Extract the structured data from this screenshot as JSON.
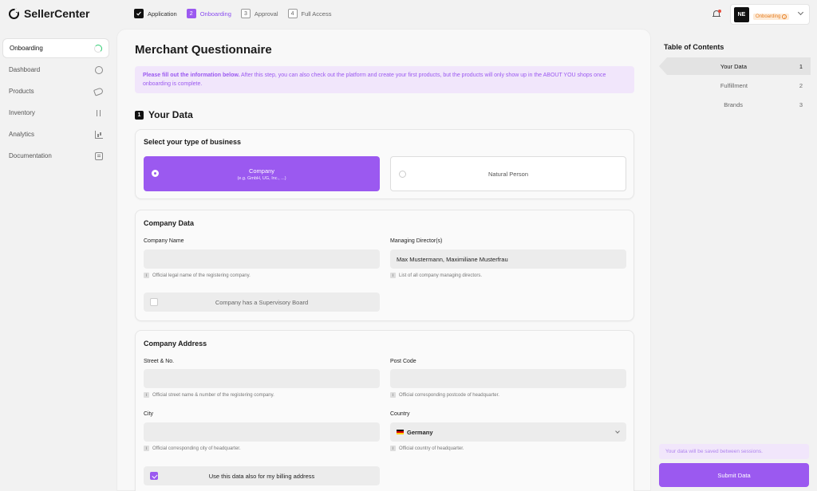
{
  "app": {
    "name": "SellerCenter"
  },
  "steps": [
    {
      "num": "",
      "label": "Application",
      "state": "done"
    },
    {
      "num": "2",
      "label": "Onboarding",
      "state": "active"
    },
    {
      "num": "3",
      "label": "Approval",
      "state": "pending"
    },
    {
      "num": "4",
      "label": "Full Access",
      "state": "pending"
    }
  ],
  "account": {
    "initials": "NE",
    "badge": "Onboarding",
    "badge_info": "i"
  },
  "sidebar": {
    "items": [
      {
        "label": "Onboarding",
        "icon": "progress-icon"
      },
      {
        "label": "Dashboard",
        "icon": "dashboard-icon"
      },
      {
        "label": "Products",
        "icon": "tag-icon"
      },
      {
        "label": "Inventory",
        "icon": "sort-icon"
      },
      {
        "label": "Analytics",
        "icon": "chart-icon"
      },
      {
        "label": "Documentation",
        "icon": "document-icon"
      }
    ]
  },
  "main": {
    "title": "Merchant Questionnaire",
    "notice_bold": "Please fill out the information below.",
    "notice_text": " After this step, you can also check out the platform and create your first products, but the products will only show up in the ABOUT YOU shops once onboarding is complete.",
    "section": {
      "num": "1",
      "title": "Your Data"
    },
    "business": {
      "title": "Select your type of business",
      "options": [
        {
          "label": "Company",
          "sub": "(e.g. GmbH, UG, Inc., ...)"
        },
        {
          "label": "Natural Person"
        }
      ]
    },
    "company": {
      "title": "Company Data",
      "name_label": "Company Name",
      "name_value": "",
      "name_help": "Official legal name of the registering company.",
      "directors_label": "Managing Director(s)",
      "directors_value": "Max Mustermann, Maximiliane Musterfrau",
      "directors_help": "List of all company managing directors.",
      "supervisory_label": "Company has a Supervisory Board"
    },
    "address": {
      "title": "Company Address",
      "street_label": "Street & No.",
      "street_help": "Official street name & number of the registering company.",
      "postcode_label": "Post Code",
      "postcode_help": "Official corresponding postcode of headquarter.",
      "city_label": "City",
      "city_help": "Official corresponding city of headquarter.",
      "country_label": "Country",
      "country_value": "Germany",
      "country_help": "Official country of headquarter.",
      "billing_label": "Use this data also for my billing address"
    }
  },
  "toc": {
    "title": "Table of Contents",
    "items": [
      {
        "label": "Your Data",
        "num": "1"
      },
      {
        "label": "Fulfillment",
        "num": "2"
      },
      {
        "label": "Brands",
        "num": "3"
      }
    ],
    "save_note": "Your data will be saved between sessions.",
    "submit": "Submit Data"
  },
  "colors": {
    "accent": "#9b59f0",
    "accent_light": "#f1e6fb",
    "warning": "#e67e22"
  }
}
